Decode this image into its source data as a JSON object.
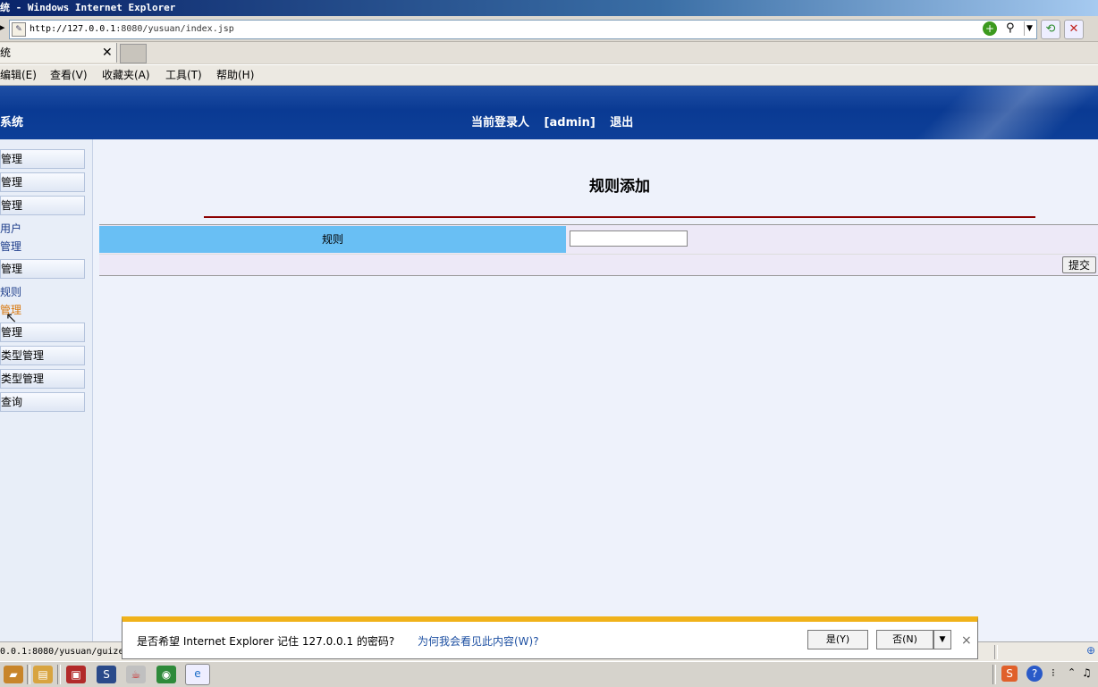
{
  "window": {
    "title": "统 - Windows Internet Explorer"
  },
  "address": {
    "url_host": "http://127.0.0.1",
    "url_rest": ":8080/yusuan/index.jsp"
  },
  "tab": {
    "label": "统",
    "close": "✕"
  },
  "menu": [
    "编辑(E)",
    "查看(V)",
    "收藏夹(A)",
    "工具(T)",
    "帮助(H)"
  ],
  "header": {
    "system_name": "系统",
    "login_label": "当前登录人",
    "login_user": "[admin]",
    "logout": "退出"
  },
  "sidebar": {
    "items": [
      {
        "label": "管理",
        "type": "button"
      },
      {
        "label": "管理",
        "type": "button"
      },
      {
        "label": "管理",
        "type": "button"
      },
      {
        "label": "用户",
        "type": "link"
      },
      {
        "label": "管理",
        "type": "link"
      },
      {
        "label": "管理",
        "type": "button"
      },
      {
        "label": "规则",
        "type": "link"
      },
      {
        "label": "管理",
        "type": "link",
        "active": true
      },
      {
        "label": "管理",
        "type": "button"
      },
      {
        "label": "类型管理",
        "type": "button"
      },
      {
        "label": "类型管理",
        "type": "button"
      },
      {
        "label": "查询",
        "type": "button"
      }
    ]
  },
  "form": {
    "title": "规则添加",
    "field_label": "规则",
    "field_value": "",
    "submit": "提交"
  },
  "status": {
    "text": "0.0.1:8080/yusuan/guize"
  },
  "notification": {
    "message": "是否希望 Internet Explorer 记住 127.0.0.1 的密码?",
    "why_link": "为何我会看见此内容(W)?",
    "yes": "是(Y)",
    "no": "否(N)",
    "close": "×"
  },
  "colors": {
    "header_blue": "#0a3a93",
    "label_cell": "#69bff4",
    "notify_bar": "#f0b21a",
    "divider_red": "#8b0000"
  }
}
